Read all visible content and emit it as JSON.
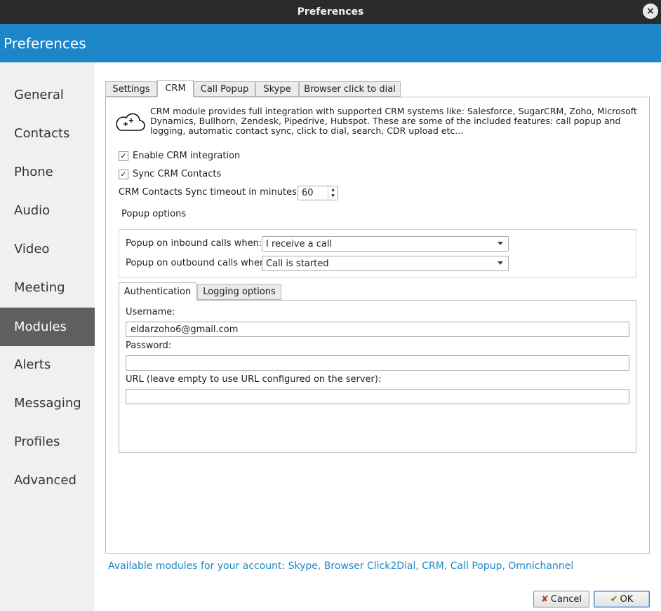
{
  "window": {
    "title": "Preferences",
    "close_glyph": "×"
  },
  "header": {
    "title": "Preferences"
  },
  "sidebar": {
    "items": [
      {
        "label": "General"
      },
      {
        "label": "Contacts"
      },
      {
        "label": "Phone"
      },
      {
        "label": "Audio"
      },
      {
        "label": "Video"
      },
      {
        "label": "Meeting"
      },
      {
        "label": "Modules",
        "active": true
      },
      {
        "label": "Alerts"
      },
      {
        "label": "Messaging"
      },
      {
        "label": "Profiles"
      },
      {
        "label": "Advanced"
      }
    ]
  },
  "tabs": [
    {
      "label": "Settings"
    },
    {
      "label": "CRM",
      "active": true
    },
    {
      "label": "Call Popup"
    },
    {
      "label": "Skype"
    },
    {
      "label": "Browser click to dial"
    }
  ],
  "crm": {
    "icon": "cloud-plus-icon",
    "description": "CRM module provides full integration with supported CRM systems like: Salesforce, SugarCRM, Zoho, Microsoft Dynamics, Bullhorn, Zendesk, Pipedrive, Hubspot. These are some of the included features: call popup and logging, automatic contact sync, click to dial, search, CDR upload etc...",
    "enable_label": "Enable CRM integration",
    "enable_checked": true,
    "sync_label": "Sync CRM Contacts",
    "sync_checked": true,
    "check_glyph": "✓",
    "timeout_label": "CRM Contacts Sync timeout in minutes",
    "timeout_value": "60",
    "popup_options_label": "Popup options",
    "inbound_label": "Popup on inbound calls when:",
    "inbound_value": "I receive a call",
    "outbound_label": "Popup on outbound calls when:",
    "outbound_value": "Call is started"
  },
  "subtabs": [
    {
      "label": "Authentication",
      "active": true
    },
    {
      "label": "Logging options"
    }
  ],
  "auth": {
    "username_label": "Username:",
    "username_value": "eldarzoho6@gmail.com",
    "password_label": "Password:",
    "password_value": "",
    "url_label": "URL (leave empty to use URL configured on the server):",
    "url_value": ""
  },
  "footer": {
    "modules_text": "Available modules for your account: Skype, Browser Click2Dial, CRM, Call Popup, Omnichannel",
    "cancel_label": "Cancel",
    "ok_label": "OK"
  },
  "colors": {
    "accent": "#1c86c8",
    "titlebar": "#2b2b2b",
    "sidebar_active": "#5f5f5f"
  }
}
